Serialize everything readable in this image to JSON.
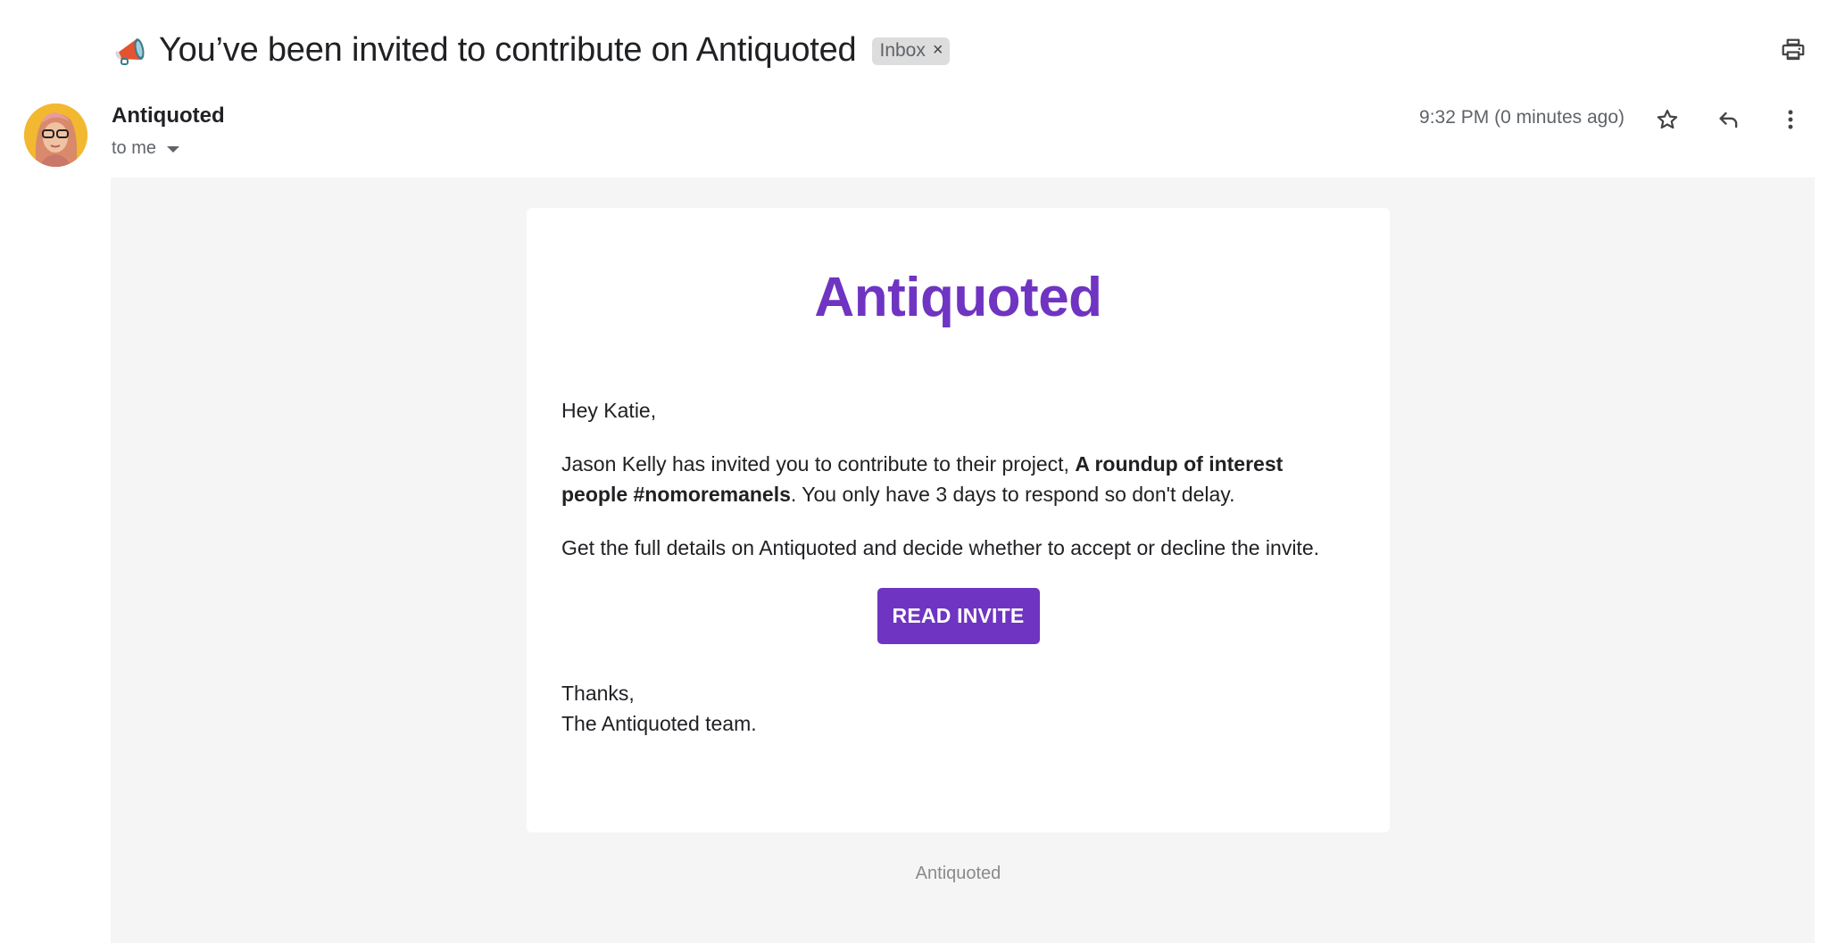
{
  "header": {
    "subject_icon": "megaphone-icon",
    "subject": "You’ve been invited to contribute on Antiquoted",
    "label": "Inbox",
    "label_remove": "×",
    "print_icon": "printer-icon"
  },
  "message": {
    "sender_name": "Antiquoted",
    "recipient": "to me",
    "timestamp": "9:32 PM (0 minutes ago)",
    "actions": [
      "star-icon",
      "reply-icon",
      "more-vert-icon"
    ]
  },
  "email": {
    "brand": "Antiquoted",
    "brand_color": "#6f34c2",
    "greeting": "Hey Katie,",
    "invite_prefix": "Jason Kelly has invited you to contribute to their project, ",
    "project_name": "A roundup of interest people #nomoremanels",
    "invite_suffix": ". You only have 3 days to respond so don't delay.",
    "details": "Get the full details on Antiquoted and decide whether to accept or decline the invite.",
    "cta_label": "READ INVITE",
    "signoff_1": "Thanks,",
    "signoff_2": "The Antiquoted team.",
    "footer": "Antiquoted"
  }
}
